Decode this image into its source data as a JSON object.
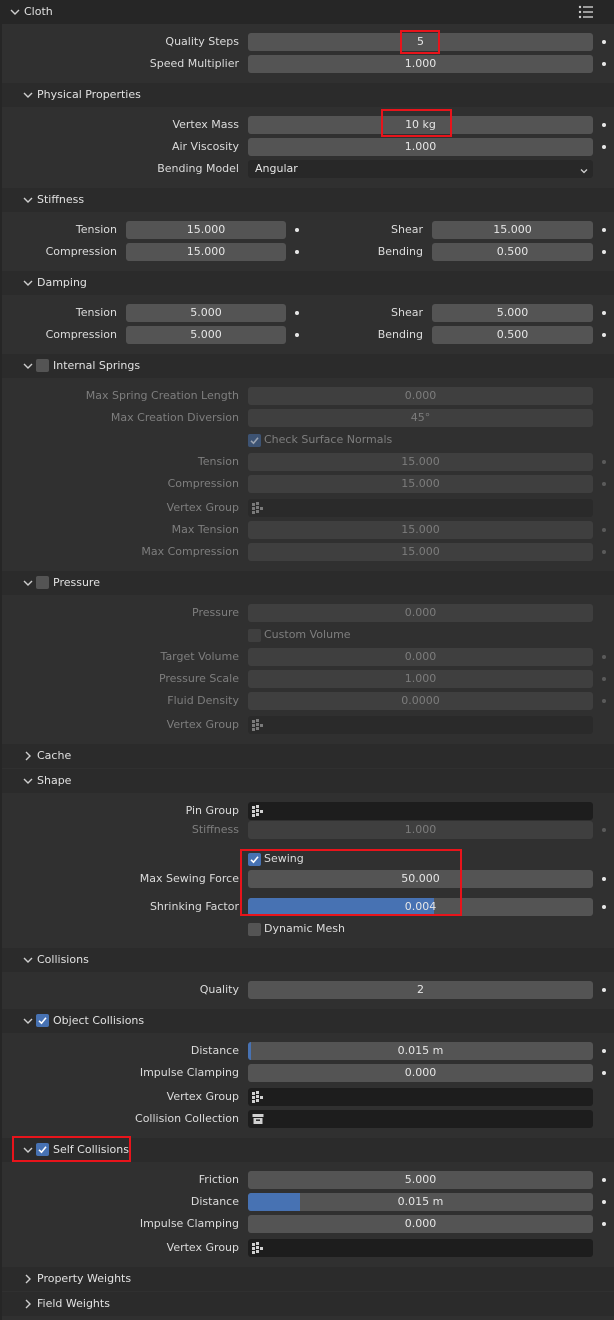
{
  "cloth": {
    "title": "Cloth",
    "quality_steps": {
      "label": "Quality Steps",
      "value": "5"
    },
    "speed_multiplier": {
      "label": "Speed Multiplier",
      "value": "1.000"
    }
  },
  "physical": {
    "title": "Physical Properties",
    "vertex_mass": {
      "label": "Vertex Mass",
      "value": "10 kg"
    },
    "air_viscosity": {
      "label": "Air Viscosity",
      "value": "1.000"
    },
    "bending_model": {
      "label": "Bending Model",
      "value": "Angular"
    }
  },
  "stiffness": {
    "title": "Stiffness",
    "tension": {
      "label": "Tension",
      "value": "15.000"
    },
    "shear": {
      "label": "Shear",
      "value": "15.000"
    },
    "compression": {
      "label": "Compression",
      "value": "15.000"
    },
    "bending": {
      "label": "Bending",
      "value": "0.500"
    }
  },
  "damping": {
    "title": "Damping",
    "tension": {
      "label": "Tension",
      "value": "5.000"
    },
    "shear": {
      "label": "Shear",
      "value": "5.000"
    },
    "compression": {
      "label": "Compression",
      "value": "5.000"
    },
    "bending": {
      "label": "Bending",
      "value": "0.500"
    }
  },
  "internal_springs": {
    "title": "Internal Springs",
    "enabled": false,
    "max_spring_creation_length": {
      "label": "Max Spring Creation Length",
      "value": "0.000"
    },
    "max_creation_diversion": {
      "label": "Max Creation Diversion",
      "value": "45°"
    },
    "check_surface_normals": {
      "label": "Check Surface Normals",
      "checked": true
    },
    "tension": {
      "label": "Tension",
      "value": "15.000"
    },
    "compression": {
      "label": "Compression",
      "value": "15.000"
    },
    "vertex_group": {
      "label": "Vertex Group",
      "value": ""
    },
    "max_tension": {
      "label": "Max Tension",
      "value": "15.000"
    },
    "max_compression": {
      "label": "Max Compression",
      "value": "15.000"
    }
  },
  "pressure": {
    "title": "Pressure",
    "enabled": false,
    "pressure": {
      "label": "Pressure",
      "value": "0.000"
    },
    "custom_volume": {
      "label": "Custom Volume",
      "checked": false
    },
    "target_volume": {
      "label": "Target Volume",
      "value": "0.000"
    },
    "pressure_scale": {
      "label": "Pressure Scale",
      "value": "1.000"
    },
    "fluid_density": {
      "label": "Fluid Density",
      "value": "0.0000"
    },
    "vertex_group": {
      "label": "Vertex Group",
      "value": ""
    }
  },
  "cache": {
    "title": "Cache"
  },
  "shape": {
    "title": "Shape",
    "pin_group": {
      "label": "Pin Group",
      "value": ""
    },
    "stiffness": {
      "label": "Stiffness",
      "value": "1.000"
    },
    "sewing": {
      "label": "Sewing",
      "checked": true
    },
    "max_sewing_force": {
      "label": "Max Sewing Force",
      "value": "50.000"
    },
    "shrinking_factor": {
      "label": "Shrinking Factor",
      "value": "0.004",
      "fill": 0.54
    },
    "dynamic_mesh": {
      "label": "Dynamic Mesh",
      "checked": false
    }
  },
  "collisions": {
    "title": "Collisions",
    "quality": {
      "label": "Quality",
      "value": "2"
    }
  },
  "object_collisions": {
    "title": "Object Collisions",
    "enabled": true,
    "distance": {
      "label": "Distance",
      "value": "0.015 m",
      "fill": 0.008
    },
    "impulse_clamping": {
      "label": "Impulse Clamping",
      "value": "0.000"
    },
    "vertex_group": {
      "label": "Vertex Group",
      "value": ""
    },
    "collision_collection": {
      "label": "Collision Collection",
      "value": ""
    }
  },
  "self_collisions": {
    "title": "Self Collisions",
    "enabled": true,
    "friction": {
      "label": "Friction",
      "value": "5.000"
    },
    "distance": {
      "label": "Distance",
      "value": "0.015 m",
      "fill": 0.15
    },
    "impulse_clamping": {
      "label": "Impulse Clamping",
      "value": "0.000"
    },
    "vertex_group": {
      "label": "Vertex Group",
      "value": ""
    }
  },
  "property_weights": {
    "title": "Property Weights"
  },
  "field_weights": {
    "title": "Field Weights"
  },
  "colors": {
    "accent": "#4772b3",
    "highlight": "#e8141b",
    "background": "#303030"
  }
}
